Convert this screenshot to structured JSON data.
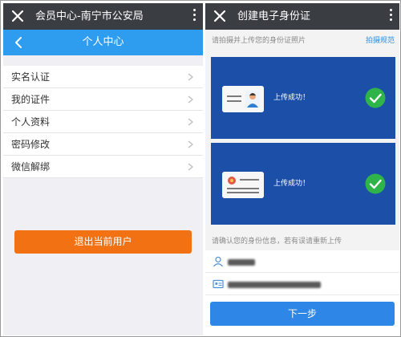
{
  "left": {
    "header": {
      "title": "会员中心-南宁市公安局"
    },
    "subheader": {
      "title": "个人中心"
    },
    "menu": [
      {
        "label": "实名认证"
      },
      {
        "label": "我的证件"
      },
      {
        "label": "个人资料"
      },
      {
        "label": "密码修改"
      },
      {
        "label": "微信解绑"
      }
    ],
    "logout_label": "退出当前用户"
  },
  "right": {
    "header": {
      "title": "创建电子身份证"
    },
    "upload_hint": "请拍摄并上传您的身份证照片",
    "guide_link": "拍摄规范",
    "cards": [
      {
        "side": "front",
        "status": "上传成功！"
      },
      {
        "side": "back",
        "status": "上传成功！"
      }
    ],
    "confirm_hint": "请确认您的身份信息，若有误请重新上传",
    "next_label": "下一步"
  },
  "colors": {
    "titlebar": "#3a3d42",
    "accent_blue": "#2e9df0",
    "card_blue": "#1c4fa8",
    "success_green": "#2fb44a",
    "logout_orange": "#f27213",
    "next_blue": "#2e86e6"
  }
}
